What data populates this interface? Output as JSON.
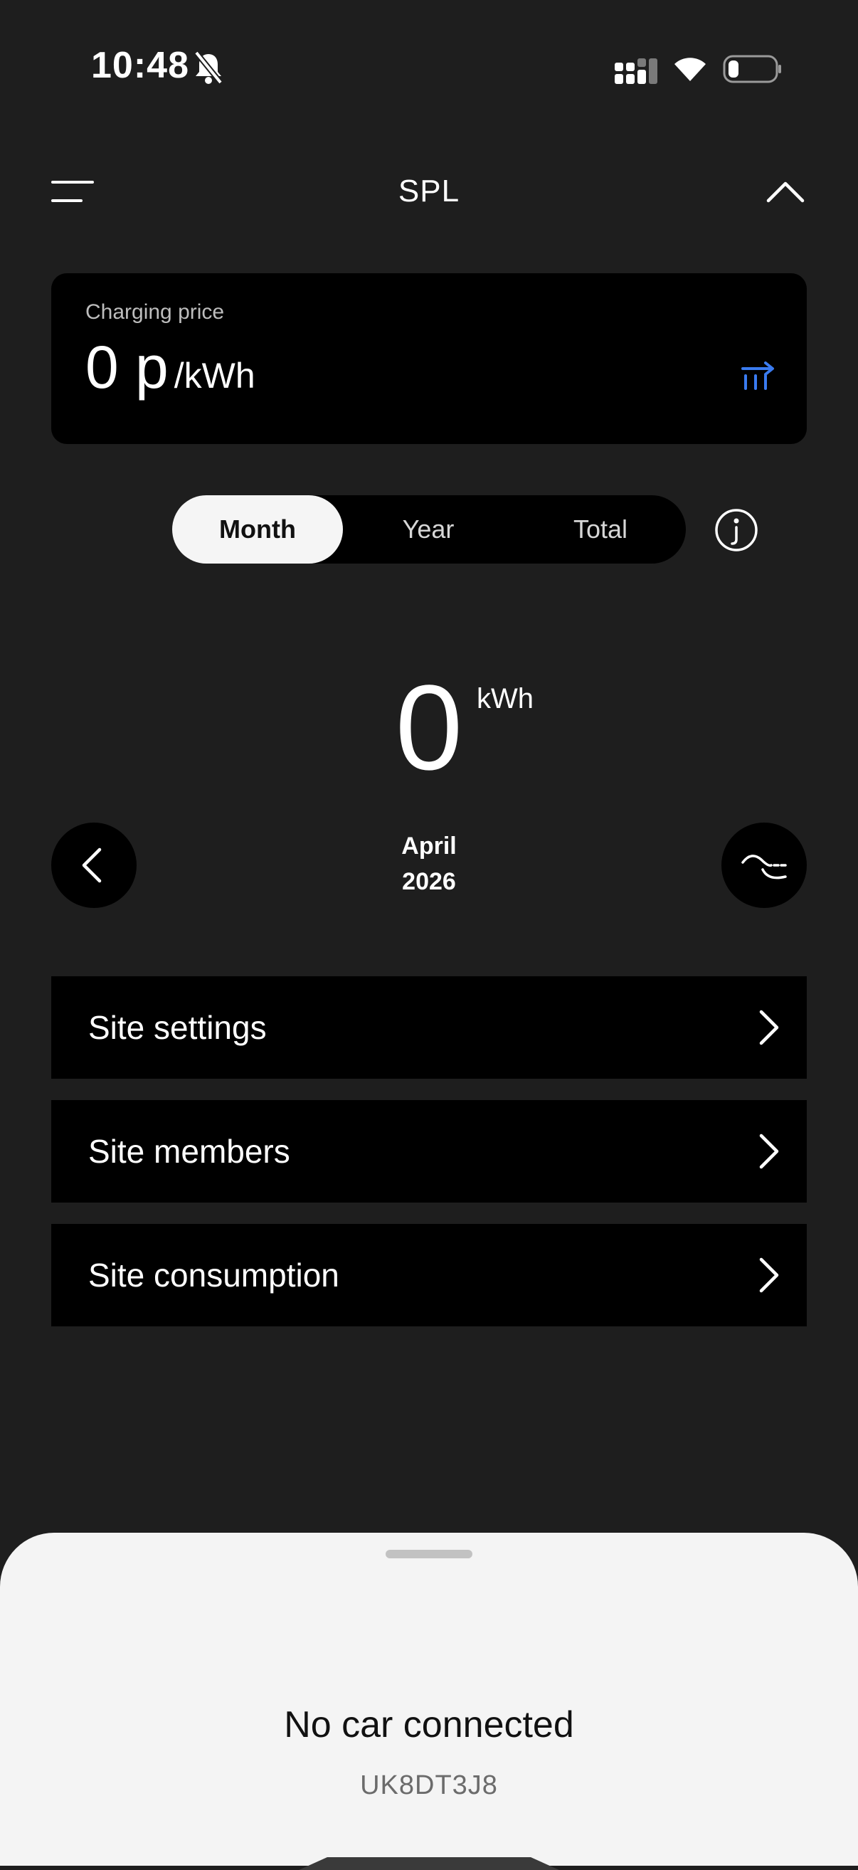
{
  "status_bar": {
    "time": "10:48"
  },
  "header": {
    "title": "SPL"
  },
  "price_card": {
    "label": "Charging price",
    "value": "0 p",
    "unit": "/kWh"
  },
  "period_tabs": {
    "items": [
      "Month",
      "Year",
      "Total"
    ],
    "selected": "Month"
  },
  "energy": {
    "value": "0",
    "unit": "kWh"
  },
  "period": {
    "month": "April",
    "year": "2026"
  },
  "menu_rows": [
    "Site settings",
    "Site members",
    "Site consumption"
  ],
  "bottom_sheet": {
    "title": "No car connected",
    "code": "UK8DT3J8"
  },
  "colors": {
    "background": "#1e1e1e",
    "card": "#000000",
    "accent": "#3a7bf0",
    "sheet": "#f4f4f4"
  },
  "icons": {
    "menu": "hamburger-icon",
    "collapse": "chevron-up-icon",
    "price_link": "tariff-arrow-icon",
    "info": "info-icon",
    "prev": "chevron-left-icon",
    "next": "wave-chart-icon",
    "row": "chevron-right-icon"
  }
}
